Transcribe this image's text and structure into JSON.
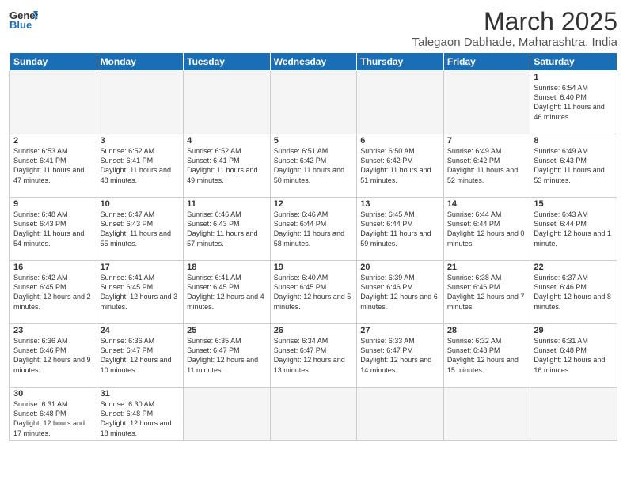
{
  "header": {
    "logo_general": "General",
    "logo_blue": "Blue",
    "title": "March 2025",
    "location": "Talegaon Dabhade, Maharashtra, India"
  },
  "days_of_week": [
    "Sunday",
    "Monday",
    "Tuesday",
    "Wednesday",
    "Thursday",
    "Friday",
    "Saturday"
  ],
  "weeks": [
    [
      {
        "day": "",
        "info": ""
      },
      {
        "day": "",
        "info": ""
      },
      {
        "day": "",
        "info": ""
      },
      {
        "day": "",
        "info": ""
      },
      {
        "day": "",
        "info": ""
      },
      {
        "day": "",
        "info": ""
      },
      {
        "day": "1",
        "info": "Sunrise: 6:54 AM\nSunset: 6:40 PM\nDaylight: 11 hours\nand 46 minutes."
      }
    ],
    [
      {
        "day": "2",
        "info": "Sunrise: 6:53 AM\nSunset: 6:41 PM\nDaylight: 11 hours\nand 47 minutes."
      },
      {
        "day": "3",
        "info": "Sunrise: 6:52 AM\nSunset: 6:41 PM\nDaylight: 11 hours\nand 48 minutes."
      },
      {
        "day": "4",
        "info": "Sunrise: 6:52 AM\nSunset: 6:41 PM\nDaylight: 11 hours\nand 49 minutes."
      },
      {
        "day": "5",
        "info": "Sunrise: 6:51 AM\nSunset: 6:42 PM\nDaylight: 11 hours\nand 50 minutes."
      },
      {
        "day": "6",
        "info": "Sunrise: 6:50 AM\nSunset: 6:42 PM\nDaylight: 11 hours\nand 51 minutes."
      },
      {
        "day": "7",
        "info": "Sunrise: 6:49 AM\nSunset: 6:42 PM\nDaylight: 11 hours\nand 52 minutes."
      },
      {
        "day": "8",
        "info": "Sunrise: 6:49 AM\nSunset: 6:43 PM\nDaylight: 11 hours\nand 53 minutes."
      }
    ],
    [
      {
        "day": "9",
        "info": "Sunrise: 6:48 AM\nSunset: 6:43 PM\nDaylight: 11 hours\nand 54 minutes."
      },
      {
        "day": "10",
        "info": "Sunrise: 6:47 AM\nSunset: 6:43 PM\nDaylight: 11 hours\nand 55 minutes."
      },
      {
        "day": "11",
        "info": "Sunrise: 6:46 AM\nSunset: 6:43 PM\nDaylight: 11 hours\nand 57 minutes."
      },
      {
        "day": "12",
        "info": "Sunrise: 6:46 AM\nSunset: 6:44 PM\nDaylight: 11 hours\nand 58 minutes."
      },
      {
        "day": "13",
        "info": "Sunrise: 6:45 AM\nSunset: 6:44 PM\nDaylight: 11 hours\nand 59 minutes."
      },
      {
        "day": "14",
        "info": "Sunrise: 6:44 AM\nSunset: 6:44 PM\nDaylight: 12 hours\nand 0 minutes."
      },
      {
        "day": "15",
        "info": "Sunrise: 6:43 AM\nSunset: 6:44 PM\nDaylight: 12 hours\nand 1 minute."
      }
    ],
    [
      {
        "day": "16",
        "info": "Sunrise: 6:42 AM\nSunset: 6:45 PM\nDaylight: 12 hours\nand 2 minutes."
      },
      {
        "day": "17",
        "info": "Sunrise: 6:41 AM\nSunset: 6:45 PM\nDaylight: 12 hours\nand 3 minutes."
      },
      {
        "day": "18",
        "info": "Sunrise: 6:41 AM\nSunset: 6:45 PM\nDaylight: 12 hours\nand 4 minutes."
      },
      {
        "day": "19",
        "info": "Sunrise: 6:40 AM\nSunset: 6:45 PM\nDaylight: 12 hours\nand 5 minutes."
      },
      {
        "day": "20",
        "info": "Sunrise: 6:39 AM\nSunset: 6:46 PM\nDaylight: 12 hours\nand 6 minutes."
      },
      {
        "day": "21",
        "info": "Sunrise: 6:38 AM\nSunset: 6:46 PM\nDaylight: 12 hours\nand 7 minutes."
      },
      {
        "day": "22",
        "info": "Sunrise: 6:37 AM\nSunset: 6:46 PM\nDaylight: 12 hours\nand 8 minutes."
      }
    ],
    [
      {
        "day": "23",
        "info": "Sunrise: 6:36 AM\nSunset: 6:46 PM\nDaylight: 12 hours\nand 9 minutes."
      },
      {
        "day": "24",
        "info": "Sunrise: 6:36 AM\nSunset: 6:47 PM\nDaylight: 12 hours\nand 10 minutes."
      },
      {
        "day": "25",
        "info": "Sunrise: 6:35 AM\nSunset: 6:47 PM\nDaylight: 12 hours\nand 11 minutes."
      },
      {
        "day": "26",
        "info": "Sunrise: 6:34 AM\nSunset: 6:47 PM\nDaylight: 12 hours\nand 13 minutes."
      },
      {
        "day": "27",
        "info": "Sunrise: 6:33 AM\nSunset: 6:47 PM\nDaylight: 12 hours\nand 14 minutes."
      },
      {
        "day": "28",
        "info": "Sunrise: 6:32 AM\nSunset: 6:48 PM\nDaylight: 12 hours\nand 15 minutes."
      },
      {
        "day": "29",
        "info": "Sunrise: 6:31 AM\nSunset: 6:48 PM\nDaylight: 12 hours\nand 16 minutes."
      }
    ],
    [
      {
        "day": "30",
        "info": "Sunrise: 6:31 AM\nSunset: 6:48 PM\nDaylight: 12 hours\nand 17 minutes."
      },
      {
        "day": "31",
        "info": "Sunrise: 6:30 AM\nSunset: 6:48 PM\nDaylight: 12 hours\nand 18 minutes."
      },
      {
        "day": "",
        "info": ""
      },
      {
        "day": "",
        "info": ""
      },
      {
        "day": "",
        "info": ""
      },
      {
        "day": "",
        "info": ""
      },
      {
        "day": "",
        "info": ""
      }
    ]
  ]
}
